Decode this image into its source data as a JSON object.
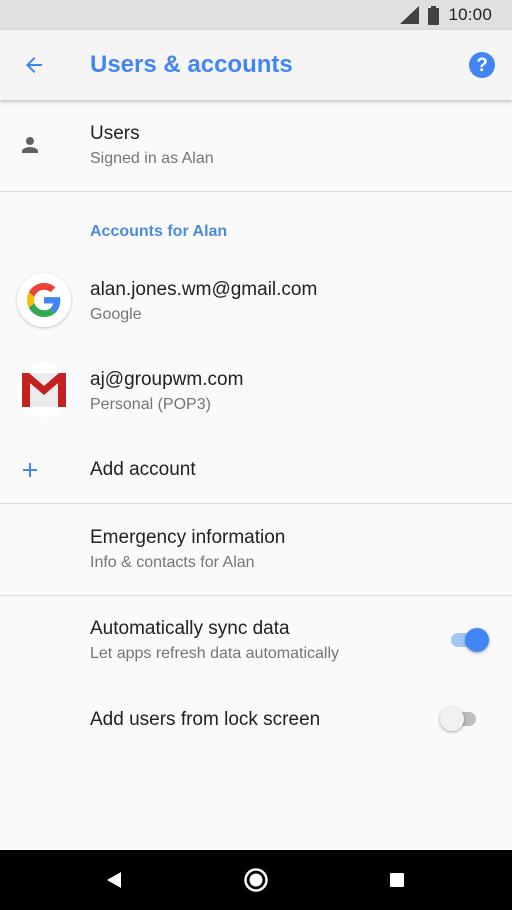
{
  "status_bar": {
    "time": "10:00",
    "icons": [
      "cell-signal-icon",
      "battery-icon"
    ]
  },
  "app_bar": {
    "title": "Users & accounts",
    "back_icon": "arrow-back-icon",
    "help_icon": "help-icon",
    "help_glyph": "?"
  },
  "users": {
    "icon": "person-icon",
    "title": "Users",
    "subtitle": "Signed in as Alan"
  },
  "accounts_section": {
    "header": "Accounts for Alan",
    "items": [
      {
        "icon": "google-g-logo",
        "title": "alan.jones.wm@gmail.com",
        "subtitle": "Google"
      },
      {
        "icon": "gmail-logo",
        "title": "aj@groupwm.com",
        "subtitle": "Personal (POP3)"
      }
    ],
    "add_account": {
      "icon": "plus-icon",
      "label": "Add account"
    }
  },
  "emergency": {
    "title": "Emergency information",
    "subtitle": "Info & contacts for Alan"
  },
  "sync": {
    "title": "Automatically sync data",
    "subtitle": "Let apps refresh data automatically",
    "enabled": true
  },
  "lock_screen_users": {
    "title": "Add users from lock screen",
    "enabled": false
  },
  "nav_bar": {
    "icons": [
      "back-triangle-icon",
      "home-circle-icon",
      "overview-square-icon"
    ]
  },
  "colors": {
    "accent": "#4285f4",
    "section_header": "#4a8be0",
    "status_bar": "#e0e0e0",
    "app_bar": "#f5f5f5",
    "background": "#fafafa"
  }
}
